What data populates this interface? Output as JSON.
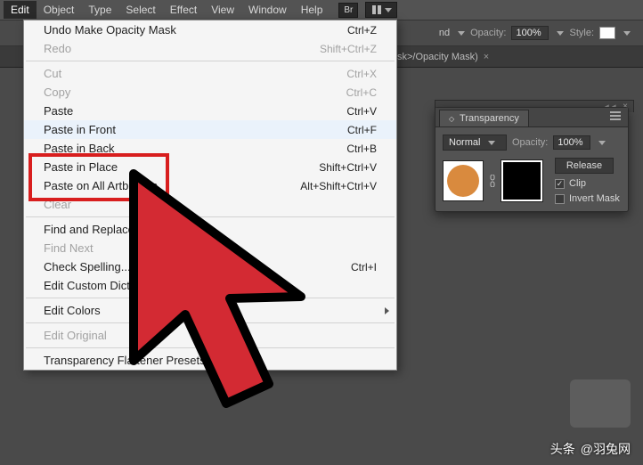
{
  "menubar": {
    "items": [
      "Edit",
      "Object",
      "Type",
      "Select",
      "Effect",
      "View",
      "Window",
      "Help"
    ],
    "active_index": 0,
    "bridge_badge": "Br"
  },
  "controlbar": {
    "partial_suffix": "nd",
    "opacity_label": "Opacity:",
    "opacity_value": "100%",
    "style_label": "Style:"
  },
  "doctab": {
    "title_suffix": "sk>/Opacity Mask)"
  },
  "edit_menu": {
    "items": [
      {
        "label": "Undo Make Opacity Mask",
        "shortcut": "Ctrl+Z",
        "disabled": false
      },
      {
        "label": "Redo",
        "shortcut": "Shift+Ctrl+Z",
        "disabled": true
      },
      {
        "sep": true
      },
      {
        "label": "Cut",
        "shortcut": "Ctrl+X",
        "disabled": true
      },
      {
        "label": "Copy",
        "shortcut": "Ctrl+C",
        "disabled": true
      },
      {
        "label": "Paste",
        "shortcut": "Ctrl+V",
        "disabled": false
      },
      {
        "label": "Paste in Front",
        "shortcut": "Ctrl+F",
        "disabled": false,
        "highlighted": true
      },
      {
        "label": "Paste in Back",
        "shortcut": "Ctrl+B",
        "disabled": false
      },
      {
        "label": "Paste in Place",
        "shortcut": "Shift+Ctrl+V",
        "disabled": false
      },
      {
        "label": "Paste on All Artboards",
        "shortcut": "Alt+Shift+Ctrl+V",
        "disabled": false
      },
      {
        "label": "Clear",
        "shortcut": "",
        "disabled": true
      },
      {
        "sep": true
      },
      {
        "label": "Find and Replace...",
        "shortcut": "",
        "disabled": false
      },
      {
        "label": "Find Next",
        "shortcut": "",
        "disabled": true
      },
      {
        "label": "Check Spelling...",
        "shortcut": "Ctrl+I",
        "disabled": false
      },
      {
        "label": "Edit Custom Dictionary...",
        "shortcut": "",
        "disabled": false
      },
      {
        "sep": true
      },
      {
        "label": "Edit Colors",
        "shortcut": "",
        "disabled": false,
        "submenu": true
      },
      {
        "sep": true
      },
      {
        "label": "Edit Original",
        "shortcut": "",
        "disabled": true
      },
      {
        "sep": true
      },
      {
        "label": "Transparency Flattener Presets...",
        "shortcut": "",
        "disabled": false
      }
    ]
  },
  "transparency_panel": {
    "title": "Transparency",
    "blend_mode": "Normal",
    "opacity_label": "Opacity:",
    "opacity_value": "100%",
    "release_button": "Release",
    "clip_label": "Clip",
    "clip_checked": true,
    "invert_label": "Invert Mask",
    "invert_checked": false,
    "content_color": "#d98a3e"
  },
  "attribution": {
    "prefix": "头条",
    "handle": "@羽兔网"
  }
}
